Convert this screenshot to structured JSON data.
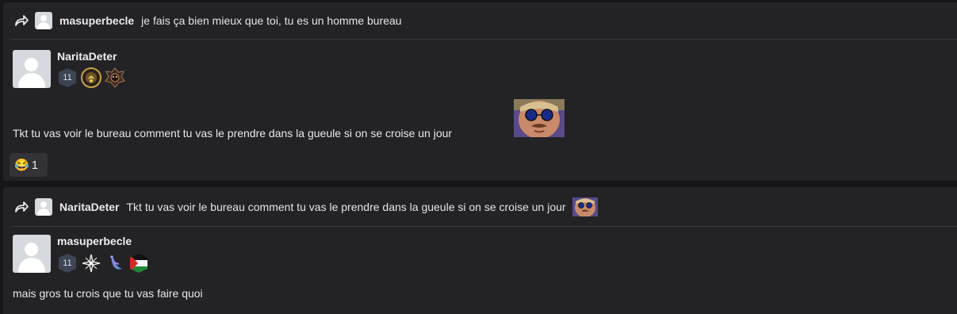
{
  "messages": [
    {
      "reply_to": {
        "username": "masuperbecle",
        "text": "je fais ça bien mieux que toi, tu es un homme bureau"
      },
      "author": "NaritaDeter",
      "level": "11",
      "badges": [
        "gold-medallion-badge",
        "dark-crest-badge"
      ],
      "text": "Tkt tu vas voir le bureau comment tu vas le prendre dans la gueule si on se croise un jour",
      "sticker": "sunglasses-man-sticker",
      "reaction": {
        "emoji": "😂",
        "count": "1"
      }
    },
    {
      "reply_to": {
        "username": "NaritaDeter",
        "text": "Tkt tu vas voir le bureau comment tu vas le prendre dans la gueule si on se croise un jour",
        "sticker": "sunglasses-man-sticker"
      },
      "author": "masuperbecle",
      "level": "11",
      "badges": [
        "compass-star-badge",
        "blue-bird-badge",
        "palestine-flag-badge"
      ],
      "text": "mais gros tu crois que tu vas faire quoi"
    }
  ],
  "colors": {
    "background": "#161618",
    "card": "#232325",
    "level_badge": "#3d4454",
    "reaction_bg": "#333337"
  }
}
